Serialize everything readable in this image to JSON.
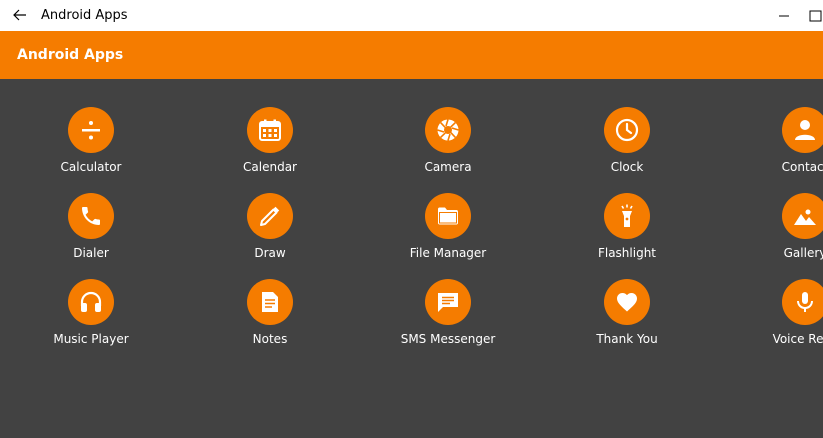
{
  "window": {
    "title": "Android Apps"
  },
  "appbar": {
    "title": "Android Apps"
  },
  "colors": {
    "accent": "#f57c00",
    "background": "#424242",
    "icon_fg": "#ffffff"
  },
  "apps": [
    {
      "label": "Calculator",
      "icon": "divide-icon"
    },
    {
      "label": "Calendar",
      "icon": "calendar-icon"
    },
    {
      "label": "Camera",
      "icon": "camera-aperture-icon"
    },
    {
      "label": "Clock",
      "icon": "clock-icon"
    },
    {
      "label": "Contact",
      "icon": "person-icon"
    },
    {
      "label": "Dialer",
      "icon": "phone-icon"
    },
    {
      "label": "Draw",
      "icon": "pencil-icon"
    },
    {
      "label": "File Manager",
      "icon": "folder-icon"
    },
    {
      "label": "Flashlight",
      "icon": "flashlight-icon"
    },
    {
      "label": "Gallery",
      "icon": "image-icon"
    },
    {
      "label": "Music Player",
      "icon": "headphones-icon"
    },
    {
      "label": "Notes",
      "icon": "document-icon"
    },
    {
      "label": "SMS Messenger",
      "icon": "message-icon"
    },
    {
      "label": "Thank You",
      "icon": "heart-icon"
    },
    {
      "label": "Voice Reco",
      "icon": "microphone-icon"
    }
  ]
}
